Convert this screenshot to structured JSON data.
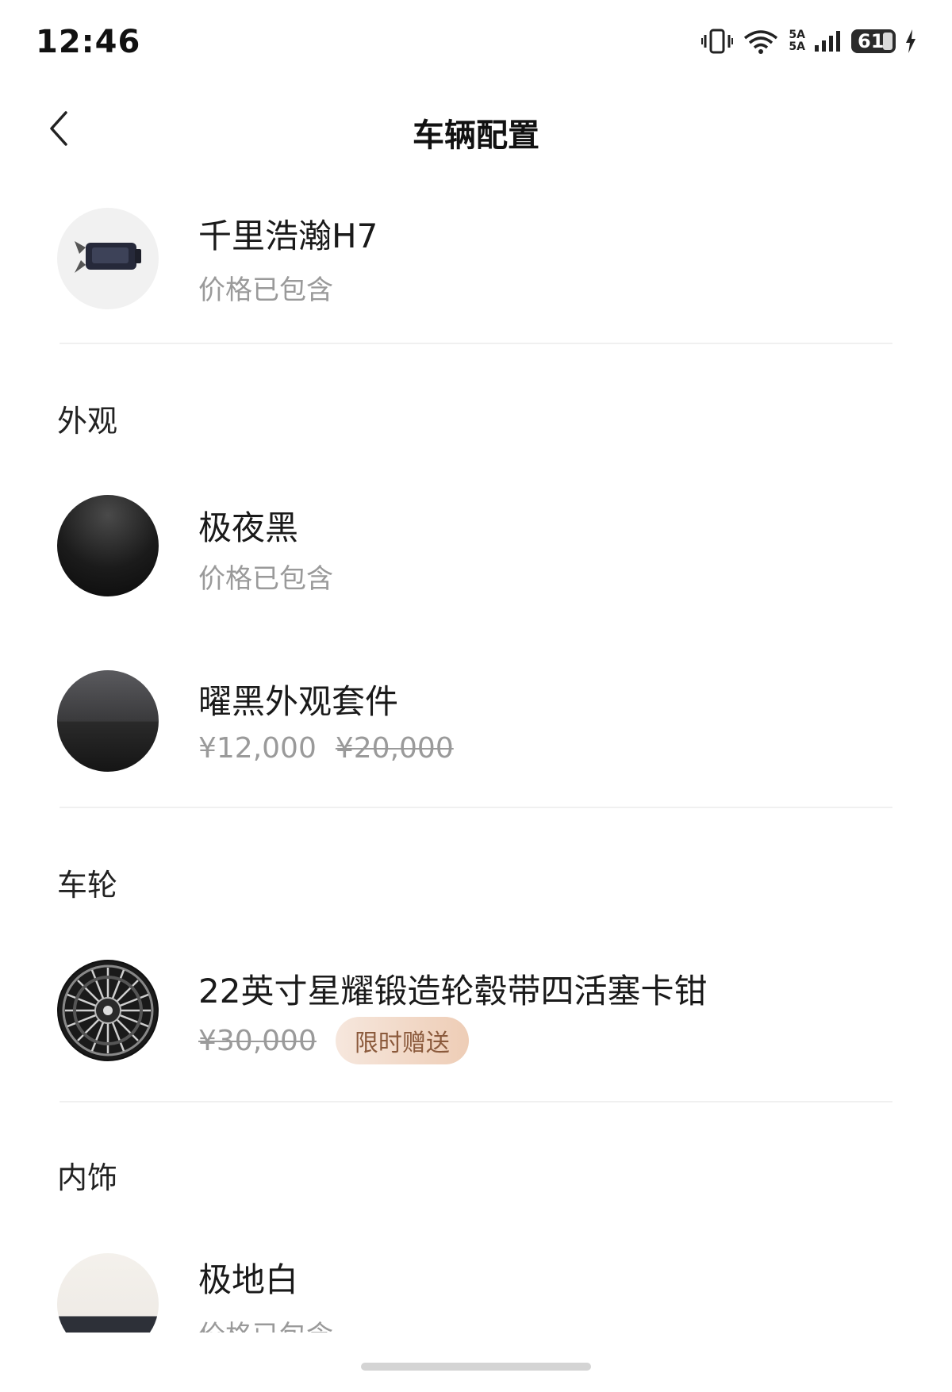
{
  "status": {
    "time": "12:46",
    "net_top": "5A",
    "net_bottom": "5A",
    "battery": "61"
  },
  "header": {
    "title": "车辆配置"
  },
  "vehicle": {
    "name": "千里浩瀚H7",
    "price_note": "价格已包含"
  },
  "sections": {
    "exterior": {
      "label": "外观",
      "items": [
        {
          "name": "极夜黑",
          "price_note": "价格已包含"
        },
        {
          "name": "曜黑外观套件",
          "price": "¥12,000",
          "original_price": "¥20,000"
        }
      ]
    },
    "wheels": {
      "label": "车轮",
      "items": [
        {
          "name": "22英寸星耀锻造轮毂带四活塞卡钳",
          "original_price": "¥30,000",
          "badge": "限时赠送"
        }
      ]
    },
    "interior": {
      "label": "内饰",
      "items": [
        {
          "name": "极地白",
          "price_note": "价格已包含"
        }
      ]
    }
  },
  "icons": {
    "back": "chevron-left-icon",
    "vibrate": "vibrate-icon",
    "wifi": "wifi-icon",
    "signal": "signal-icon",
    "battery": "battery-icon",
    "charging": "charging-icon"
  },
  "colors": {
    "badge_text": "#8b5a3c",
    "muted_text": "#9a9a9a",
    "divider": "#f0f0f0"
  }
}
